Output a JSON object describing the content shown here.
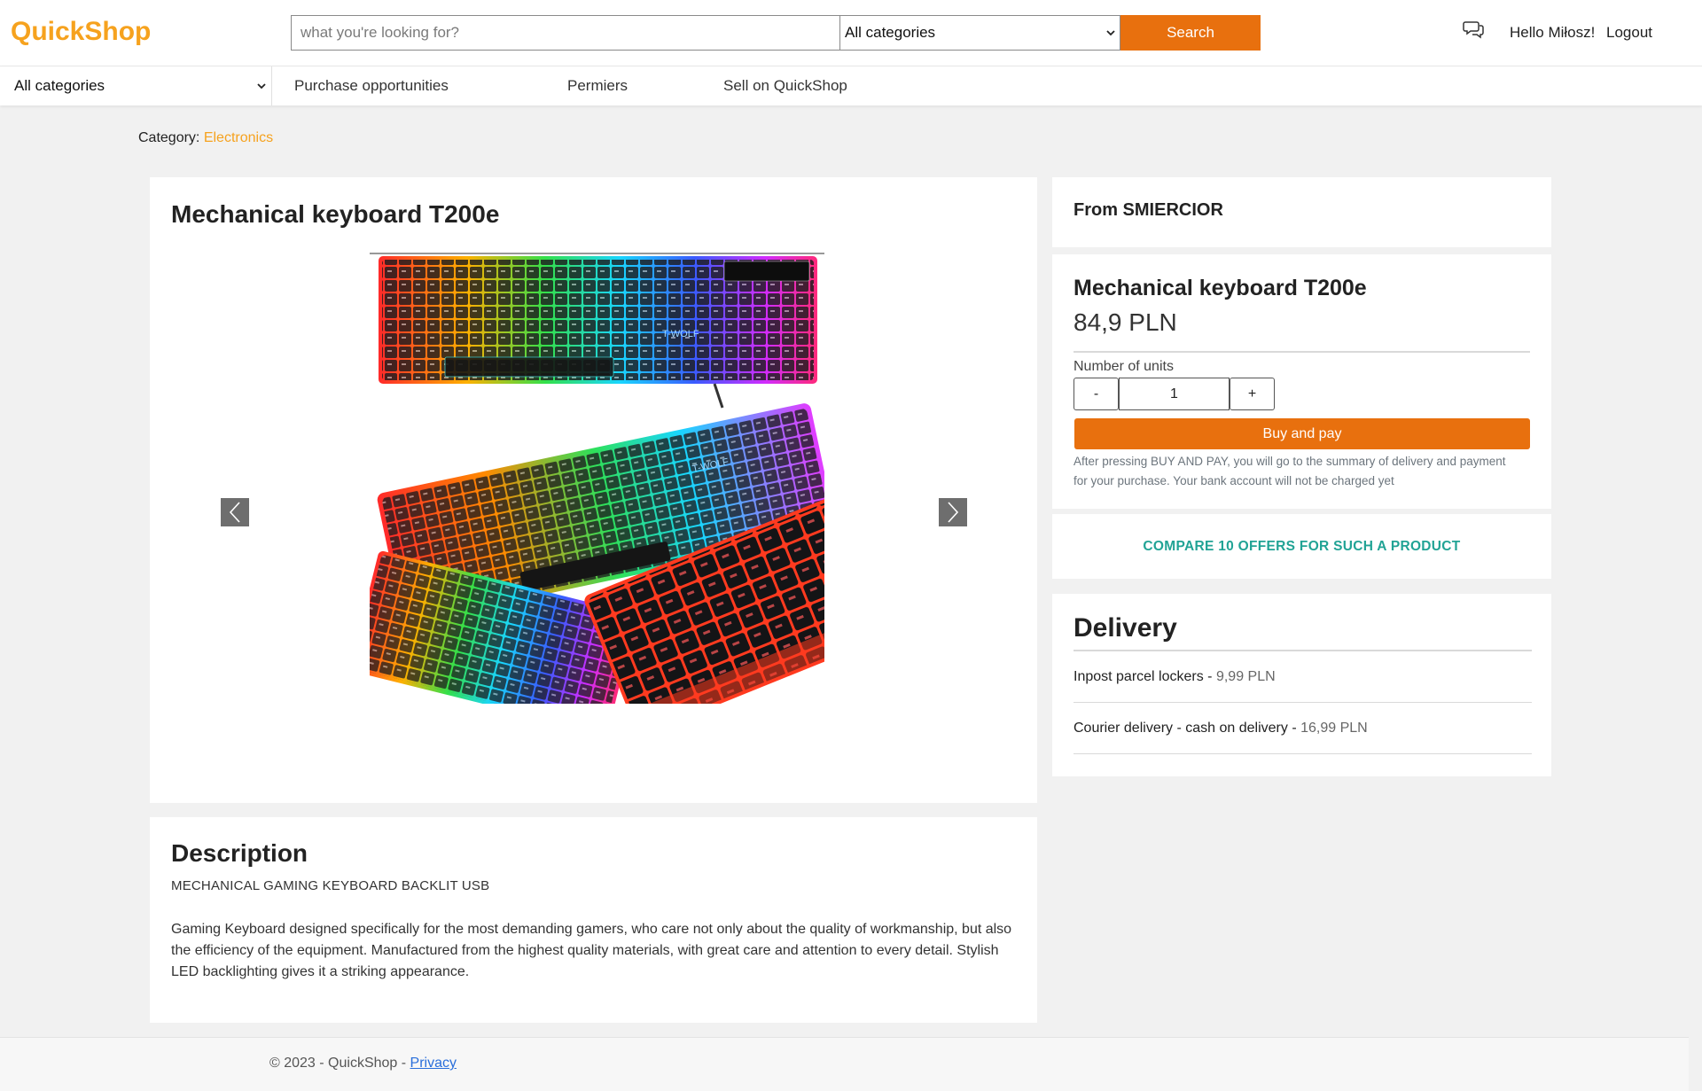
{
  "header": {
    "logo": "QuickShop",
    "search_placeholder": "what you're looking for?",
    "search_category": "All categories",
    "search_button": "Search",
    "greeting": "Hello Miłosz!",
    "logout": "Logout"
  },
  "nav": {
    "category_select": "All categories",
    "links": [
      "Purchase opportunities",
      "Permiers",
      "Sell on QuickShop"
    ]
  },
  "breadcrumb": {
    "label": "Category:",
    "category": "Electronics"
  },
  "product": {
    "title": "Mechanical keyboard T200e",
    "image_brand": "T-WOLF",
    "description_title": "Description",
    "description_subtitle": "MECHANICAL GAMING KEYBOARD BACKLIT USB",
    "description_body": "Gaming Keyboard designed specifically for the most demanding gamers, who care not only about the quality of workmanship, but also the efficiency of the equipment. Manufactured from the highest quality materials, with great care and attention to every detail. Stylish LED backlighting gives it a striking appearance."
  },
  "seller": {
    "from_label": "From SMIERCIOR"
  },
  "purchase": {
    "title": "Mechanical keyboard T200e",
    "price": "84,9 PLN",
    "units_label": "Number of units",
    "minus": "-",
    "quantity": "1",
    "plus": "+",
    "buy_button": "Buy and pay",
    "note": "After pressing BUY AND PAY, you will go to the summary of delivery and payment for your purchase. Your bank account will not be charged yet"
  },
  "compare": {
    "label": "COMPARE 10 OFFERS FOR SUCH A PRODUCT"
  },
  "delivery": {
    "title": "Delivery",
    "options": [
      {
        "name": "Inpost parcel lockers - ",
        "price": "9,99 PLN"
      },
      {
        "name": "Courier delivery - cash on delivery - ",
        "price": "16,99 PLN"
      }
    ]
  },
  "footer": {
    "copyright": "© 2023 - QuickShop - ",
    "privacy": "Privacy"
  },
  "colors": {
    "brand": "#f6a21e",
    "accent": "#e8700e",
    "compare": "#21a395",
    "background": "#f1f1f1"
  }
}
